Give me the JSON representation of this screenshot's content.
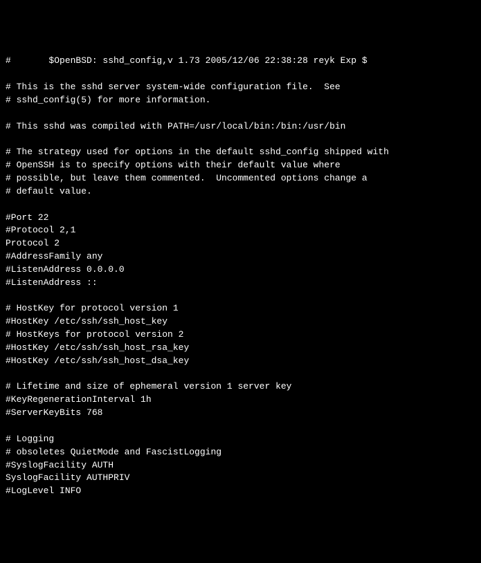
{
  "lines": [
    "#       $OpenBSD: sshd_config,v 1.73 2005/12/06 22:38:28 reyk Exp $",
    "",
    "# This is the sshd server system-wide configuration file.  See",
    "# sshd_config(5) for more information.",
    "",
    "# This sshd was compiled with PATH=/usr/local/bin:/bin:/usr/bin",
    "",
    "# The strategy used for options in the default sshd_config shipped with",
    "# OpenSSH is to specify options with their default value where",
    "# possible, but leave them commented.  Uncommented options change a",
    "# default value.",
    "",
    "#Port 22",
    "#Protocol 2,1",
    "Protocol 2",
    "#AddressFamily any",
    "#ListenAddress 0.0.0.0",
    "#ListenAddress ::",
    "",
    "# HostKey for protocol version 1",
    "#HostKey /etc/ssh/ssh_host_key",
    "# HostKeys for protocol version 2",
    "#HostKey /etc/ssh/ssh_host_rsa_key",
    "#HostKey /etc/ssh/ssh_host_dsa_key",
    "",
    "# Lifetime and size of ephemeral version 1 server key",
    "#KeyRegenerationInterval 1h",
    "#ServerKeyBits 768",
    "",
    "# Logging",
    "# obsoletes QuietMode and FascistLogging",
    "#SyslogFacility AUTH",
    "SyslogFacility AUTHPRIV",
    "#LogLevel INFO"
  ]
}
